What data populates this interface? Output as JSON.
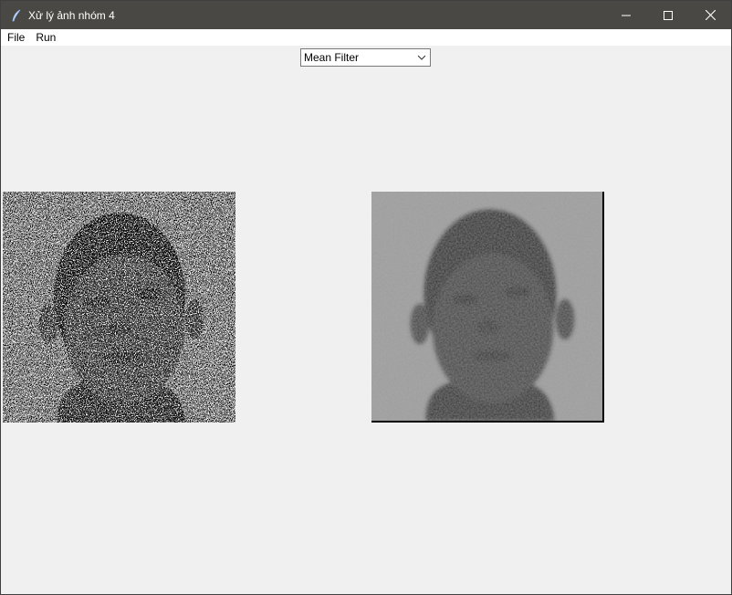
{
  "window": {
    "title": "Xử lý ảnh nhóm 4",
    "icon": "feather-icon",
    "controls": [
      "minimize-icon",
      "maximize-icon",
      "close-icon"
    ]
  },
  "menubar": {
    "items": [
      {
        "label": "File"
      },
      {
        "label": "Run"
      }
    ]
  },
  "filter_select": {
    "value": "Mean Filter",
    "icon": "chevron-down-icon"
  },
  "images": {
    "left": {
      "description_icon": "noisy-face-image"
    },
    "right": {
      "description_icon": "filtered-face-image"
    }
  },
  "colors": {
    "titlebar": "#494844",
    "background": "#f0f0f0",
    "menubar": "#ffffff"
  }
}
